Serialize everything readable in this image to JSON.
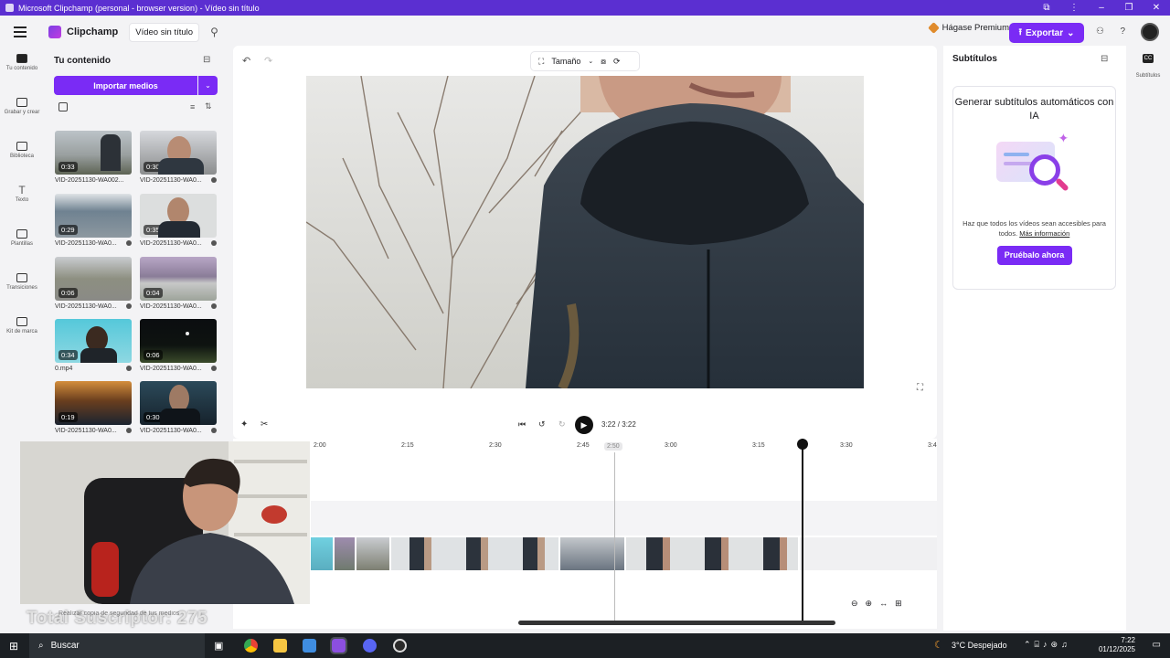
{
  "window": {
    "title": "Microsoft Clipchamp (personal - browser version) - Vídeo sin título"
  },
  "header": {
    "brand": "Clipchamp",
    "project_name": "Vídeo sin título",
    "premium_label": "Hágase Premium",
    "export_label": "Exportar"
  },
  "rail": {
    "items": [
      {
        "label": "Tu contenido",
        "icon": "folder-icon"
      },
      {
        "label": "Grabar y crear",
        "icon": "camera-icon"
      },
      {
        "label": "Biblioteca",
        "icon": "library-icon"
      },
      {
        "label": "Texto",
        "icon": "text-icon"
      },
      {
        "label": "Plantillas",
        "icon": "templates-icon"
      },
      {
        "label": "Transiciones",
        "icon": "transitions-icon"
      },
      {
        "label": "Kit de marca",
        "icon": "brand-kit-icon"
      }
    ]
  },
  "content": {
    "title": "Tu contenido",
    "import_label": "Importar medios",
    "media": [
      {
        "duration": "0:33",
        "name": "VID-20251130-WA002..."
      },
      {
        "duration": "0:30",
        "name": "VID-20251130-WA0..."
      },
      {
        "duration": "0:29",
        "name": "VID-20251130-WA0..."
      },
      {
        "duration": "0:35",
        "name": "VID-20251130-WA0..."
      },
      {
        "duration": "0:06",
        "name": "VID-20251130-WA0..."
      },
      {
        "duration": "0:04",
        "name": "VID-20251130-WA0..."
      },
      {
        "duration": "0:34",
        "name": "0.mp4"
      },
      {
        "duration": "0:06",
        "name": "VID-20251130-WA0..."
      },
      {
        "duration": "0:19",
        "name": "VID-20251130-WA0..."
      },
      {
        "duration": "0:30",
        "name": "VID-20251130-WA0..."
      }
    ]
  },
  "preview": {
    "size_label": "Tamaño",
    "time_current": "3:22",
    "time_total": "3:22",
    "time_display": "3:22 / 3:22"
  },
  "timeline": {
    "ticks": [
      "2:00",
      "2:15",
      "2:30",
      "2:45",
      "2:50",
      "3:00",
      "3:15",
      "3:30",
      "3:4"
    ]
  },
  "subtitles": {
    "title": "Subtítulos",
    "card_title": "Generar subtítulos automáticos con IA",
    "card_text": "Haz que todos los vídeos sean accesibles para todos.",
    "more_link": "Más información",
    "try_label": "Pruébalo ahora",
    "rail_label": "Subtítulos"
  },
  "overlay": {
    "subscribers": "Total Suscriptor: 275",
    "save_note": "Realizar copia de seguridad de tus medios"
  },
  "taskbar": {
    "search_placeholder": "Buscar",
    "weather": "3°C  Despejado",
    "time": "7:22",
    "date": "01/12/2025"
  }
}
